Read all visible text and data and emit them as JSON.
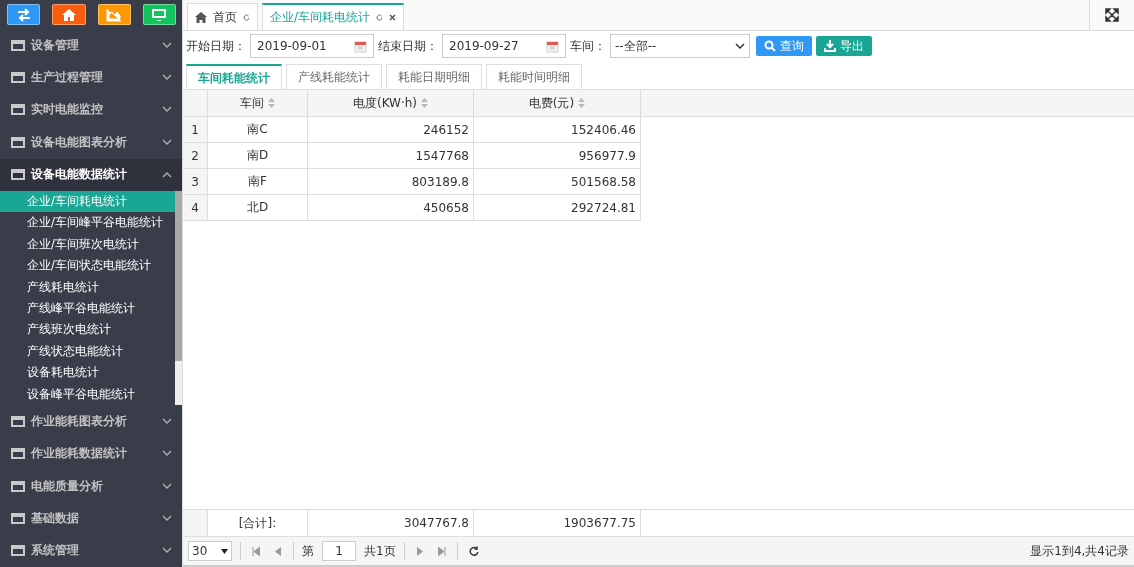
{
  "sidebar": {
    "quick_buttons": [
      {
        "kind": "swap",
        "color": "#2f98f4"
      },
      {
        "kind": "home",
        "color": "#f85c0c"
      },
      {
        "kind": "chart",
        "color": "#ff9800"
      },
      {
        "kind": "monitor",
        "color": "#13c35d"
      }
    ],
    "groups_before": [
      {
        "label": "设备管理",
        "expanded": false
      },
      {
        "label": "生产过程管理",
        "expanded": false
      },
      {
        "label": "实时电能监控",
        "expanded": false
      },
      {
        "label": "设备电能图表分析",
        "expanded": false
      }
    ],
    "open_group": {
      "label": "设备电能数据统计",
      "expanded": true,
      "children": [
        {
          "label": "企业/车间耗电统计",
          "selected": true
        },
        {
          "label": "企业/车间峰平谷电能统计",
          "selected": false
        },
        {
          "label": "企业/车间班次电统计",
          "selected": false
        },
        {
          "label": "企业/车间状态电能统计",
          "selected": false
        },
        {
          "label": "产线耗电统计",
          "selected": false
        },
        {
          "label": "产线峰平谷电能统计",
          "selected": false
        },
        {
          "label": "产线班次电统计",
          "selected": false
        },
        {
          "label": "产线状态电能统计",
          "selected": false
        },
        {
          "label": "设备耗电统计",
          "selected": false
        },
        {
          "label": "设备峰平谷电能统计",
          "selected": false
        }
      ]
    },
    "groups_after": [
      {
        "label": "作业能耗图表分析",
        "expanded": false
      },
      {
        "label": "作业能耗数据统计",
        "expanded": false
      },
      {
        "label": "电能质量分析",
        "expanded": false
      },
      {
        "label": "基础数据",
        "expanded": false
      },
      {
        "label": "系统管理",
        "expanded": false
      }
    ]
  },
  "page_tabs": [
    {
      "label": "首页",
      "selected": false,
      "kind": "home"
    },
    {
      "label": "企业/车间耗电统计",
      "selected": true,
      "kind": "closable"
    }
  ],
  "filters": {
    "start_label": "开始日期：",
    "start_value": "2019-09-01",
    "end_label": "结束日期：",
    "end_value": "2019-09-27",
    "workshop_label": "车间：",
    "workshop_value": "--全部--",
    "query_button": "查询",
    "export_button": "导出"
  },
  "sub_tabs": [
    {
      "label": "车间耗能统计",
      "selected": true
    },
    {
      "label": "产线耗能统计",
      "selected": false
    },
    {
      "label": "耗能日期明细",
      "selected": false
    },
    {
      "label": "耗能时间明细",
      "selected": false
    }
  ],
  "table": {
    "columns": [
      "车间",
      "电度(KW·h)",
      "电费(元)"
    ],
    "rows": [
      {
        "index": "1",
        "workshop": "南C",
        "energy": "246152",
        "cost": "152406.46"
      },
      {
        "index": "2",
        "workshop": "南D",
        "energy": "1547768",
        "cost": "956977.9"
      },
      {
        "index": "3",
        "workshop": "南F",
        "energy": "803189.8",
        "cost": "501568.58"
      },
      {
        "index": "4",
        "workshop": "北D",
        "energy": "450658",
        "cost": "292724.81"
      }
    ],
    "footer": {
      "label": "[合计]:",
      "energy": "3047767.8",
      "cost": "1903677.75"
    }
  },
  "pager": {
    "page_size": "30",
    "page_prefix": "第",
    "page": "1",
    "page_suffix": "共1页",
    "summary": "显示1到4,共4记录"
  }
}
